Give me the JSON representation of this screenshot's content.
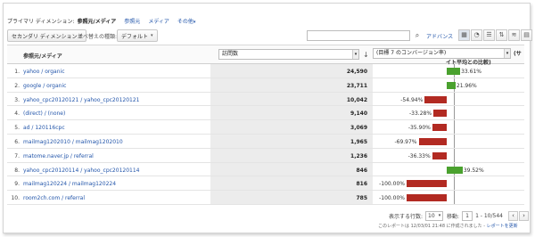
{
  "dimension_bar": {
    "label": "プライマリ ディメンション:",
    "current": "参照元/メディア",
    "links": [
      "参照元",
      "メディア",
      "その他"
    ]
  },
  "toolbar": {
    "secondary_dimension": "セカンダリ ディメンション",
    "sort_type_label": "並べ替えの種類:",
    "sort_type_value": "デフォルト",
    "search_placeholder": "",
    "search_icon": "search-icon",
    "advanced_label": "アドバンス",
    "view_icons": [
      "table-view-icon",
      "pie-view-icon",
      "performance-view-icon",
      "comparison-view-icon",
      "term-cloud-view-icon",
      "pivot-view-icon"
    ]
  },
  "table": {
    "headers": {
      "dimension": "参照元/メディア",
      "metric": "訪問数",
      "sort_icon": "sort-down-icon",
      "compare_metric": "(目標 7 のコンバージョン率)",
      "compare_side": "(サ",
      "compare_sub": "イト平均との比較)"
    },
    "rows": [
      {
        "num": "1.",
        "dimension": "yahoo / organic",
        "visits": "24,590",
        "pct": 33.61,
        "pct_label": "33.61%"
      },
      {
        "num": "2.",
        "dimension": "google / organic",
        "visits": "23,711",
        "pct": 21.96,
        "pct_label": "21.96%"
      },
      {
        "num": "3.",
        "dimension": "yahoo_cpc20120121 / yahoo_cpc20120121",
        "visits": "10,042",
        "pct": -54.94,
        "pct_label": "-54.94%"
      },
      {
        "num": "4.",
        "dimension": "(direct) / (none)",
        "visits": "9,140",
        "pct": -33.28,
        "pct_label": "-33.28%"
      },
      {
        "num": "5.",
        "dimension": "ad / 120116cpc",
        "visits": "3,069",
        "pct": -35.9,
        "pct_label": "-35.90%"
      },
      {
        "num": "6.",
        "dimension": "mailmag1202010 / mailmag1202010",
        "visits": "1,965",
        "pct": -69.97,
        "pct_label": "-69.97%"
      },
      {
        "num": "7.",
        "dimension": "matome.naver.jp / referral",
        "visits": "1,236",
        "pct": -36.33,
        "pct_label": "-36.33%"
      },
      {
        "num": "8.",
        "dimension": "yahoo_cpc20120114 / yahoo_cpc20120114",
        "visits": "846",
        "pct": 39.52,
        "pct_label": "39.52%"
      },
      {
        "num": "9.",
        "dimension": "mailmag120224 / mailmag120224",
        "visits": "816",
        "pct": -100.0,
        "pct_label": "-100.00%"
      },
      {
        "num": "10.",
        "dimension": "room2ch.com / referral",
        "visits": "785",
        "pct": -100.0,
        "pct_label": "-100.00%"
      }
    ]
  },
  "pager": {
    "rows_label": "表示する行数:",
    "rows_value": "10",
    "goto_label": "移動:",
    "goto_value": "1",
    "range": "1 - 10/544"
  },
  "footer": {
    "created": "このレポートは 12/03/01 21:48 に作成されました",
    "refresh": "レポートを更新"
  },
  "colors": {
    "positive": "#4aa12e",
    "negative": "#b22a22",
    "link": "#2255aa"
  }
}
